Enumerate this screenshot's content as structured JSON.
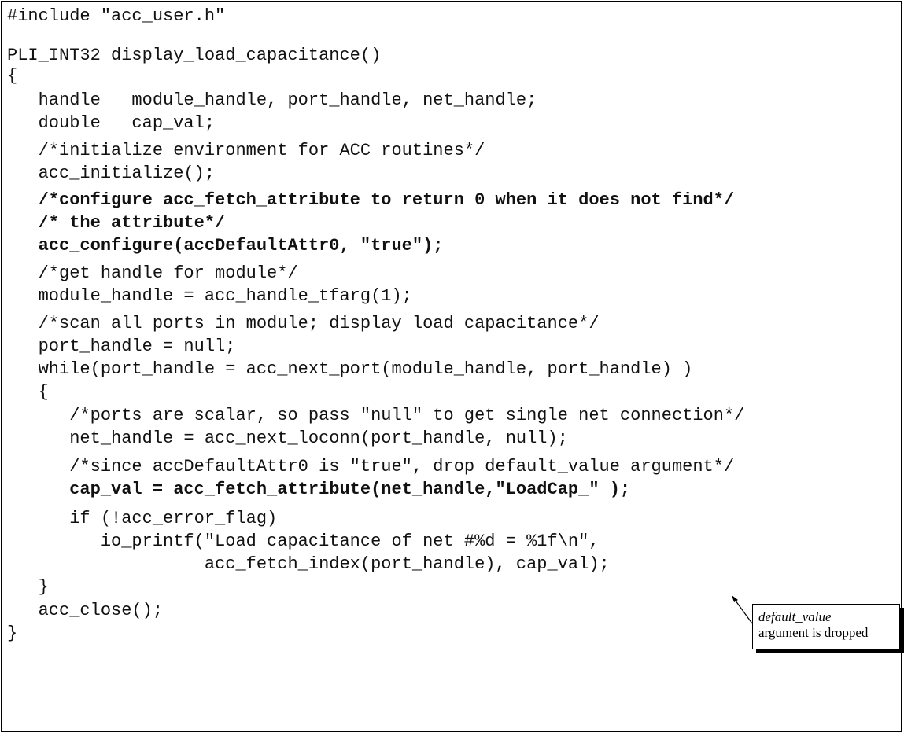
{
  "code_lines": [
    {
      "text": "#include \"acc_user.h\"",
      "bold": false
    },
    {
      "text": "PLI_INT32 display_load_capacitance()",
      "bold": false
    },
    {
      "text": "{",
      "bold": false
    },
    {
      "text": "   handle   module_handle, port_handle, net_handle;",
      "bold": false
    },
    {
      "text": "   double   cap_val;",
      "bold": false
    },
    {
      "text": "   /*initialize environment for ACC routines*/",
      "bold": false
    },
    {
      "text": "   acc_initialize();",
      "bold": false
    },
    {
      "text": "   /*configure acc_fetch_attribute to return 0 when it does not find*/",
      "bold": true
    },
    {
      "text": "   /* the attribute*/",
      "bold": true
    },
    {
      "text": "   acc_configure(accDefaultAttr0, \"true\");",
      "bold": true
    },
    {
      "text": "   /*get handle for module*/",
      "bold": false
    },
    {
      "text": "   module_handle = acc_handle_tfarg(1);",
      "bold": false
    },
    {
      "text": "   /*scan all ports in module; display load capacitance*/",
      "bold": false
    },
    {
      "text": "   port_handle = null;",
      "bold": false
    },
    {
      "text": "   while(port_handle = acc_next_port(module_handle, port_handle) )",
      "bold": false
    },
    {
      "text": "   {",
      "bold": false
    },
    {
      "text": "      /*ports are scalar, so pass \"null\" to get single net connection*/",
      "bold": false
    },
    {
      "text": "      net_handle = acc_next_loconn(port_handle, null);",
      "bold": false
    },
    {
      "text": "      /*since accDefaultAttr0 is \"true\", drop default_value argument*/",
      "bold": false
    },
    {
      "text": "      cap_val = acc_fetch_attribute(net_handle,\"LoadCap_\" );",
      "bold": true
    },
    {
      "text": "      if (!acc_error_flag)",
      "bold": false
    },
    {
      "text": "         io_printf(\"Load capacitance of net #%d = %1f\\n\",",
      "bold": false
    },
    {
      "text": "                   acc_fetch_index(port_handle), cap_val);",
      "bold": false
    },
    {
      "text": "   }",
      "bold": false
    },
    {
      "text": "   acc_close();",
      "bold": false
    },
    {
      "text": "}",
      "bold": false
    }
  ],
  "callout": {
    "title": "default_value",
    "body": "argument is dropped"
  }
}
